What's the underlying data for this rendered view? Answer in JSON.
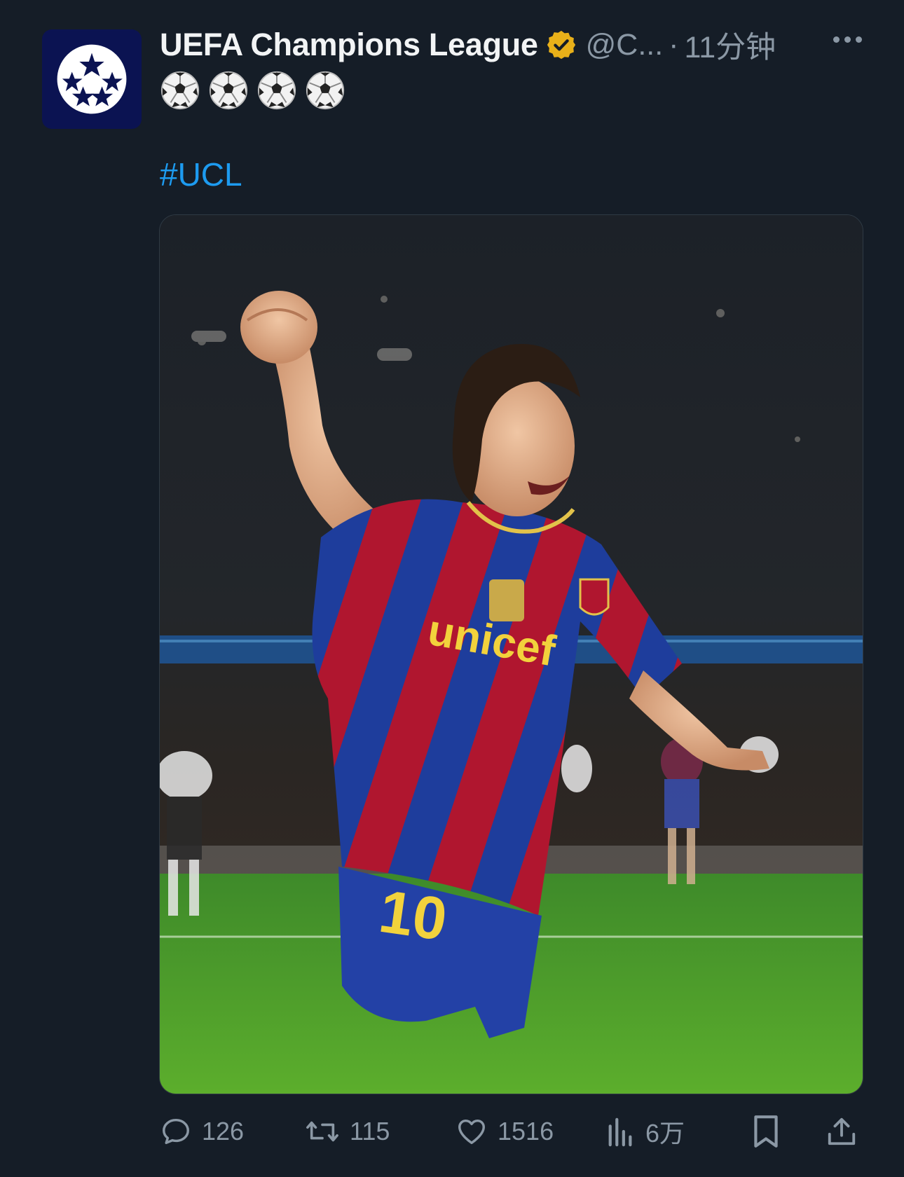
{
  "tweet": {
    "author_name": "UEFA Champions League",
    "handle": "@C...",
    "separator": "·",
    "time": "11分钟",
    "text_emoji_count": 4,
    "hashtag": "#UCL",
    "image_alt_subject": "player celebrating",
    "image_text": {
      "jersey_sponsor": "unicef",
      "jersey_number": "10"
    }
  },
  "actions": {
    "replies": "126",
    "retweets": "115",
    "likes": "1516",
    "views": "6万"
  },
  "colors": {
    "background": "#151d27",
    "link": "#1d9bf0",
    "muted": "#8b98a5",
    "verified_badge": "#e8b019",
    "avatar_bg": "#0b1352"
  }
}
